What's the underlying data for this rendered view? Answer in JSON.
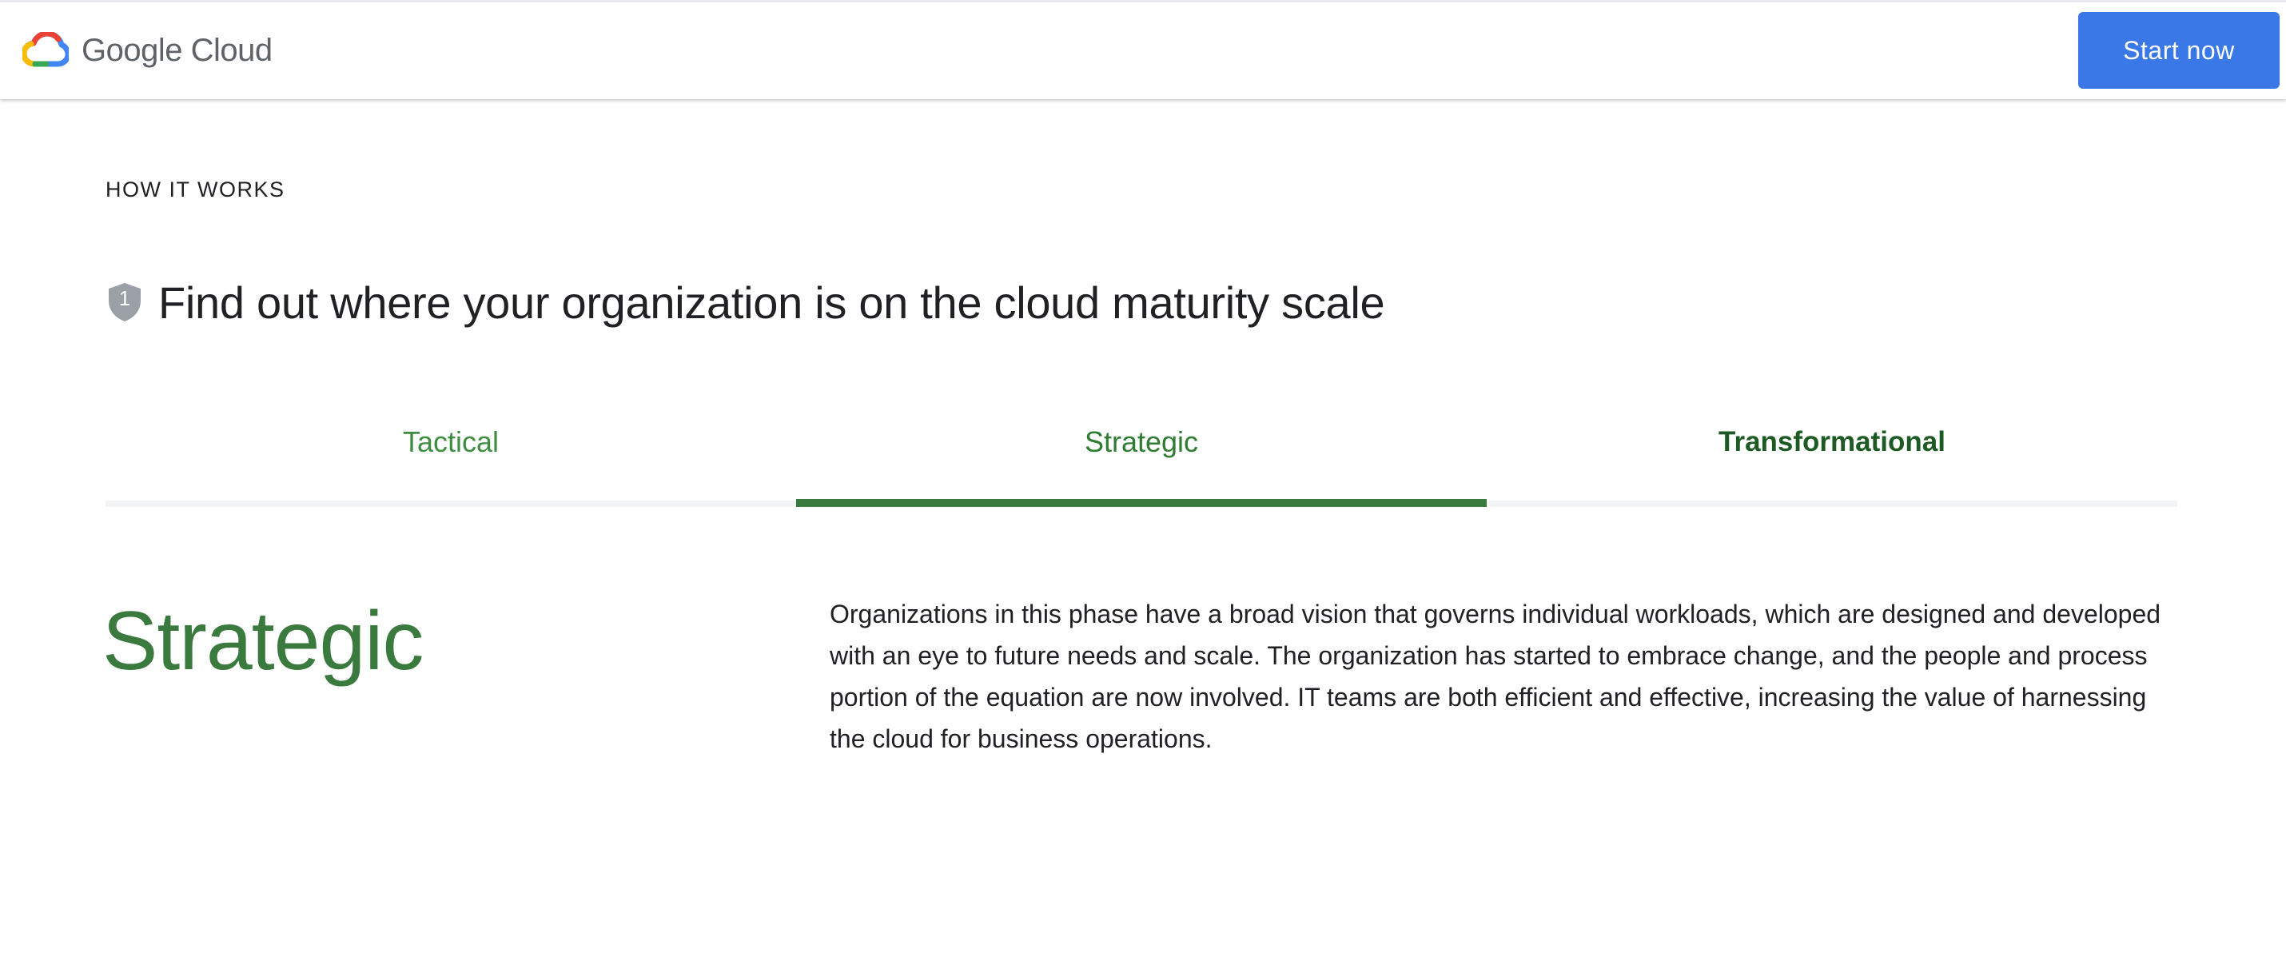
{
  "header": {
    "logo_text": "Google Cloud",
    "cta_label": "Start now"
  },
  "section": {
    "eyebrow": "HOW IT WORKS",
    "step_number": "1",
    "heading": "Find out where your organization is on the cloud maturity scale"
  },
  "tabs": [
    {
      "label": "Tactical",
      "selected": false
    },
    {
      "label": "Strategic",
      "selected": true
    },
    {
      "label": "Transformational",
      "selected": false
    }
  ],
  "panel": {
    "title": "Strategic",
    "body": "Organizations in this phase have a broad vision that governs individual workloads, which are designed and developed with an eye to future needs and scale. The organization has started to embrace change, and the people and process portion of the equation are now involved. IT teams are both efficient and effective, increasing the value of harnessing the cloud for business operations."
  },
  "colors": {
    "brand_blue": "#3b78e7",
    "accent_green": "#3a7a3e",
    "shield_gray": "#9aa0a6"
  },
  "icons": [
    "google-cloud-logo-icon",
    "shield-icon"
  ]
}
